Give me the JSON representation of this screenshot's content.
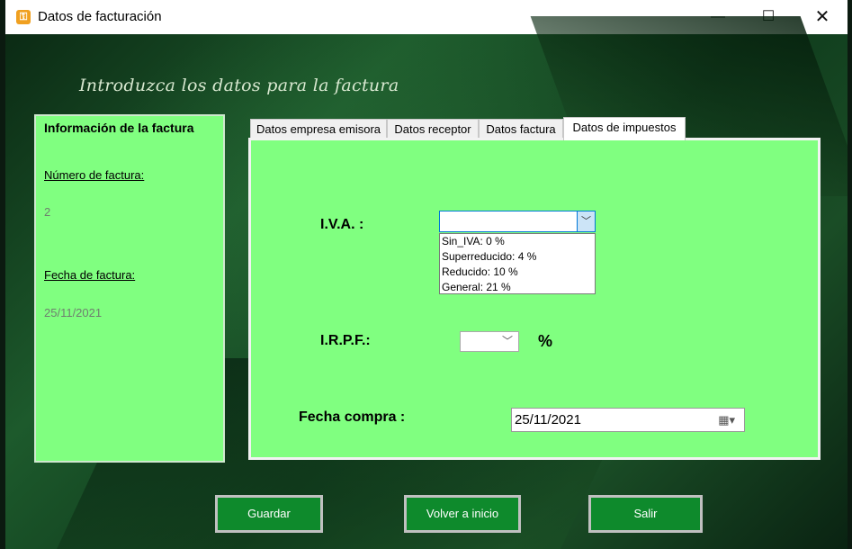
{
  "window": {
    "title": "Datos de facturación",
    "minimize_label": "—",
    "maximize_label": "☐",
    "close_label": "✕"
  },
  "heading": "Introduzca los datos para la factura",
  "info_panel": {
    "title": "Información de la factura",
    "invoice_number_label": "Número de factura:",
    "invoice_number": "2",
    "invoice_date_label": "Fecha de factura:",
    "invoice_date": "25/11/2021"
  },
  "tabs": [
    {
      "label": "Datos empresa emisora"
    },
    {
      "label": "Datos receptor"
    },
    {
      "label": "Datos factura"
    },
    {
      "label": "Datos de impuestos",
      "active": true
    }
  ],
  "taxes": {
    "iva_label": "I.V.A. :",
    "iva_value": "",
    "iva_options": [
      "Sin_IVA: 0 %",
      "Superreducido: 4 %",
      "Reducido: 10 %",
      "General: 21 %"
    ],
    "irpf_label": "I.R.P.F.:",
    "irpf_value": "",
    "irpf_unit": "%",
    "purchase_date_label": "Fecha compra :",
    "purchase_date": "25/11/2021"
  },
  "buttons": {
    "save": "Guardar",
    "back": "Volver a inicio",
    "exit": "Salir"
  },
  "icons": {
    "app": "key-icon",
    "combo_arrow": "chevron-down-icon",
    "calendar": "calendar-icon"
  },
  "colors": {
    "panel": "#80ff80",
    "button": "#0e8a2c"
  }
}
